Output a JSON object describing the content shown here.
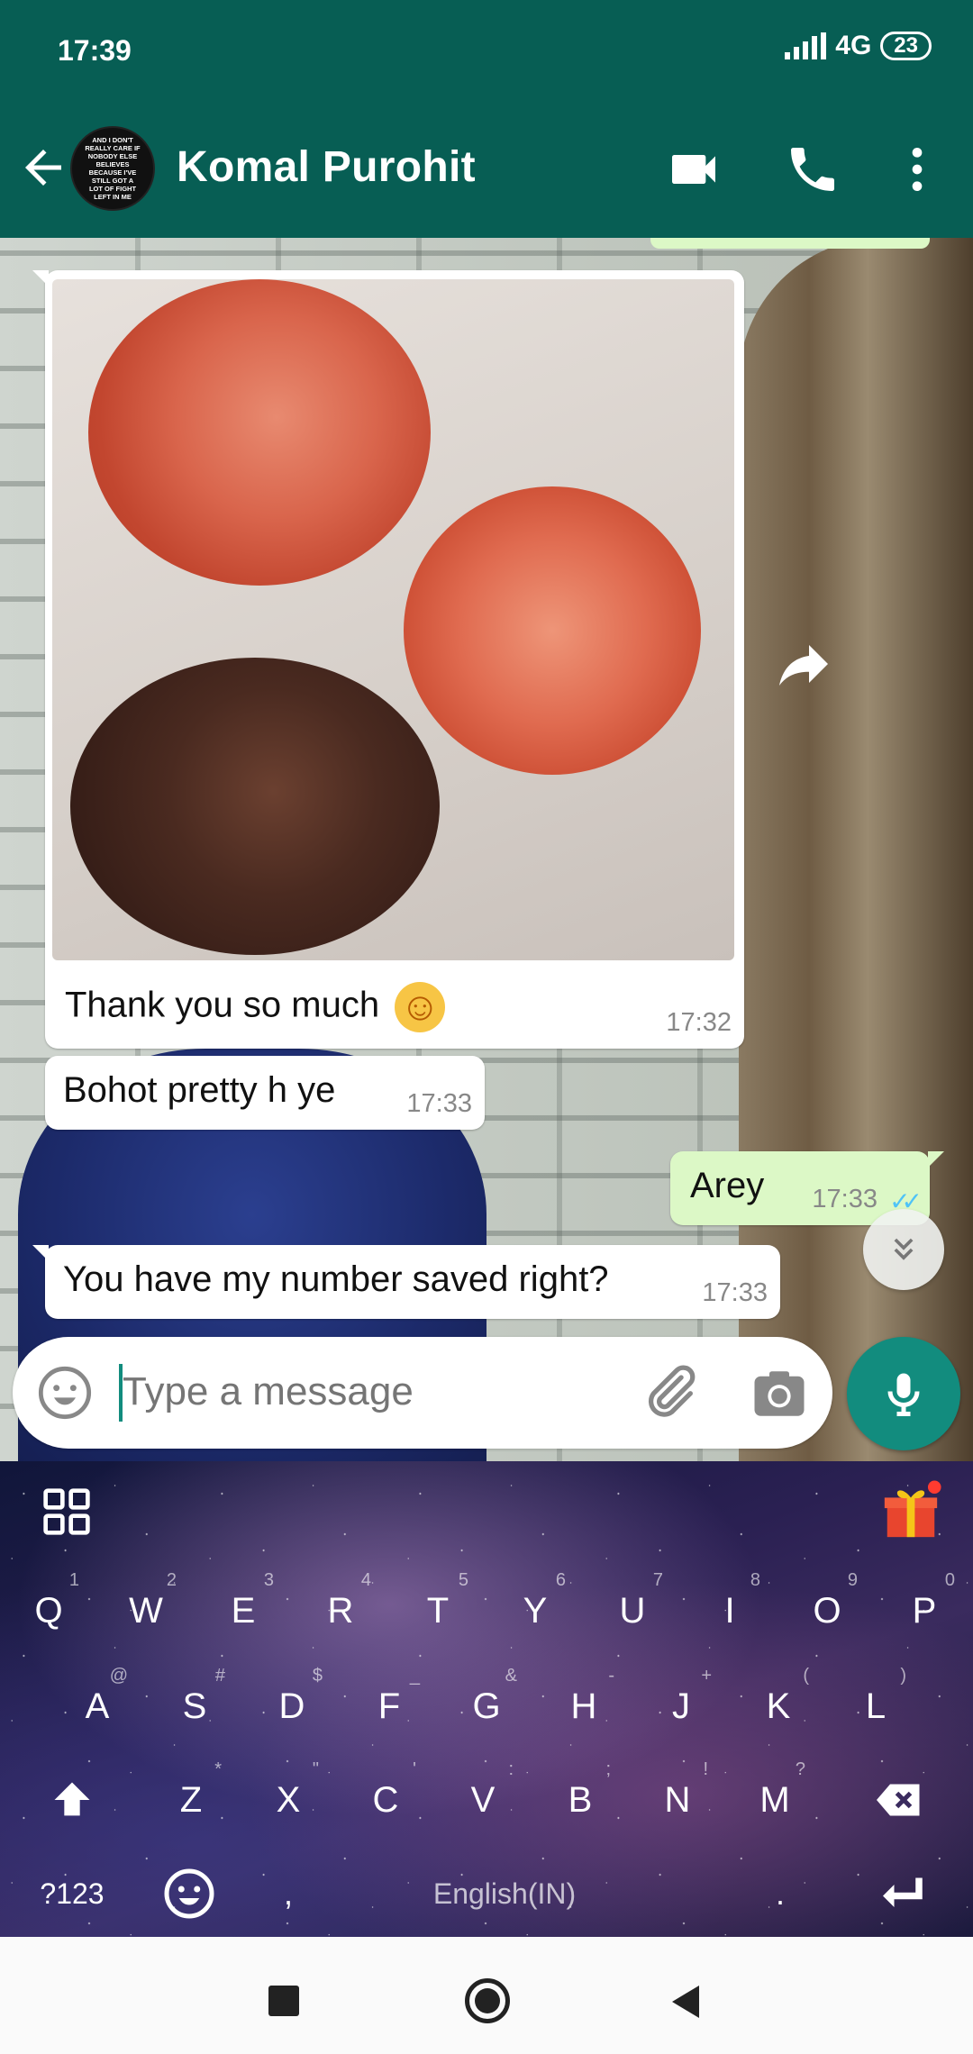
{
  "status_bar": {
    "time": "17:39",
    "network": "4G",
    "battery": "23"
  },
  "header": {
    "contact_name": "Komal Purohit",
    "avatar_text": "AND I DON'T REALLY CARE IF NOBODY ELSE BELIEVES BECAUSE I'VE STILL GOT A LOT OF FIGHT LEFT IN ME",
    "icons": [
      "back-arrow-icon",
      "video-call-icon",
      "phone-icon",
      "more-vert-icon"
    ]
  },
  "messages": [
    {
      "type": "image",
      "direction": "in",
      "caption": "Thank you so much",
      "emoji": "☺",
      "time": "17:32"
    },
    {
      "type": "text",
      "direction": "in",
      "text": "Bohot pretty h ye",
      "time": "17:33"
    },
    {
      "type": "text",
      "direction": "out",
      "text": "Arey",
      "time": "17:33",
      "ticks": "✓✓"
    },
    {
      "type": "text",
      "direction": "in",
      "text": "You have my number saved right?",
      "time": "17:33"
    }
  ],
  "composer": {
    "placeholder": "Type a message"
  },
  "keyboard": {
    "row1": [
      "Q",
      "W",
      "E",
      "R",
      "T",
      "Y",
      "U",
      "I",
      "O",
      "P"
    ],
    "row1_hints": [
      "1",
      "2",
      "3",
      "4",
      "5",
      "6",
      "7",
      "8",
      "9",
      "0"
    ],
    "row2": [
      "A",
      "S",
      "D",
      "F",
      "G",
      "H",
      "J",
      "K",
      "L"
    ],
    "row2_hints": [
      "@",
      "#",
      "$",
      "_",
      "&",
      "-",
      "+",
      "(",
      ")"
    ],
    "row3": [
      "Z",
      "X",
      "C",
      "V",
      "B",
      "N",
      "M"
    ],
    "row3_hints": [
      "*",
      "\"",
      "'",
      ":",
      ";",
      "!",
      "?"
    ],
    "symbols_key": "?123",
    "comma": ",",
    "period": ".",
    "space_label": "English(IN)"
  }
}
